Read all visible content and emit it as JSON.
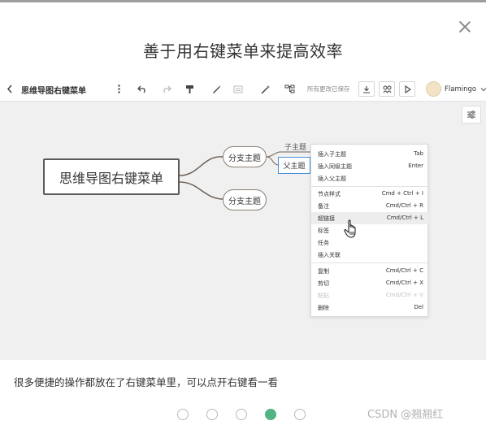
{
  "dialog": {
    "title": "善于用右键菜单来提高效率",
    "description": "很多便捷的操作都放在了右键菜单里，可以点开右键看一看",
    "page_dots": {
      "count": 5,
      "active_index": 3
    },
    "watermark": "CSDN @翘翘红"
  },
  "toolbar": {
    "doc_title": "思维导图右键菜单",
    "saved_status": "所有更改已保存",
    "theme_name": "Flamingo",
    "icons": [
      "back-icon",
      "more-icon",
      "undo-icon",
      "redo-icon",
      "format-painter-icon",
      "pen-icon",
      "style-icon",
      "magic-icon",
      "layout-icon",
      "download-icon",
      "share-icon",
      "play-icon",
      "settings-icon"
    ]
  },
  "mindmap": {
    "root": "思维导图右键菜单",
    "branch_1": "分支主题",
    "branch_2": "分支主题",
    "child_label": "子主题",
    "parent_label": "父主题"
  },
  "context_menu": {
    "groups": [
      [
        {
          "label": "插入子主题",
          "shortcut": "Tab"
        },
        {
          "label": "插入同级主题",
          "shortcut": "Enter"
        },
        {
          "label": "插入父主题",
          "shortcut": ""
        }
      ],
      [
        {
          "label": "节点样式",
          "shortcut": "Cmd + Ctrl + I"
        },
        {
          "label": "备注",
          "shortcut": "Cmd/Ctrl + R"
        },
        {
          "label": "超链接",
          "shortcut": "Cmd/Ctrl + L"
        },
        {
          "label": "标签",
          "shortcut": ""
        },
        {
          "label": "任务",
          "shortcut": ""
        },
        {
          "label": "插入关联",
          "shortcut": ""
        }
      ],
      [
        {
          "label": "复制",
          "shortcut": "Cmd/Ctrl + C"
        },
        {
          "label": "剪切",
          "shortcut": "Cmd/Ctrl + X"
        },
        {
          "label": "粘贴",
          "shortcut": "Cmd/Ctrl + V"
        },
        {
          "label": "删除",
          "shortcut": "Del"
        }
      ]
    ],
    "highlighted": "超链接",
    "disabled": "粘贴"
  },
  "colors": {
    "accent": "#52b383",
    "selection": "#4a90d9",
    "connector": "#6e6259"
  }
}
